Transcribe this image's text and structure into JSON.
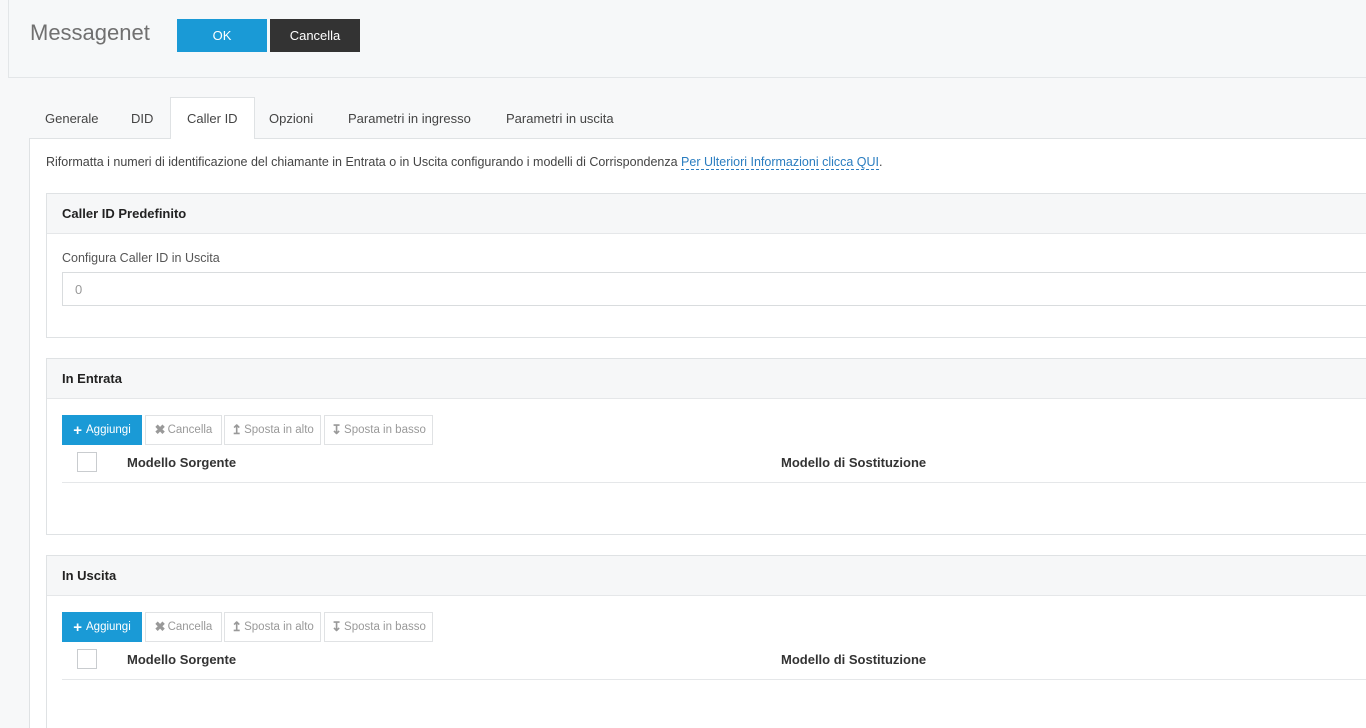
{
  "header": {
    "title": "Messagenet",
    "ok_label": "OK",
    "cancel_label": "Cancella"
  },
  "tabs": [
    {
      "label": "Generale",
      "active": false
    },
    {
      "label": "DID",
      "active": false
    },
    {
      "label": "Caller ID",
      "active": true
    },
    {
      "label": "Opzioni",
      "active": false
    },
    {
      "label": "Parametri in ingresso",
      "active": false
    },
    {
      "label": "Parametri in uscita",
      "active": false
    }
  ],
  "intro": {
    "text": "Riformatta i numeri di identificazione del chiamante in Entrata o in Uscita configurando i modelli di Corrispondenza ",
    "link": "Per Ulteriori Informazioni clicca QUI",
    "suffix": "."
  },
  "default_callerid": {
    "title": "Caller ID Predefinito",
    "field_label": "Configura Caller ID in Uscita",
    "field_value": "0"
  },
  "inbound": {
    "title": "In Entrata",
    "toolbar": {
      "add": "Aggiungi",
      "delete": "Cancella",
      "move_up": "Sposta in alto",
      "move_down": "Sposta in basso"
    },
    "columns": [
      "Modello Sorgente",
      "Modello di Sostituzione"
    ]
  },
  "outbound": {
    "title": "In Uscita",
    "toolbar": {
      "add": "Aggiungi",
      "delete": "Cancella",
      "move_up": "Sposta in alto",
      "move_down": "Sposta in basso"
    },
    "columns": [
      "Modello Sorgente",
      "Modello di Sostituzione"
    ]
  },
  "colors": {
    "primary": "#1a9ad6",
    "dark": "#333333",
    "link": "#2a7dc0"
  }
}
